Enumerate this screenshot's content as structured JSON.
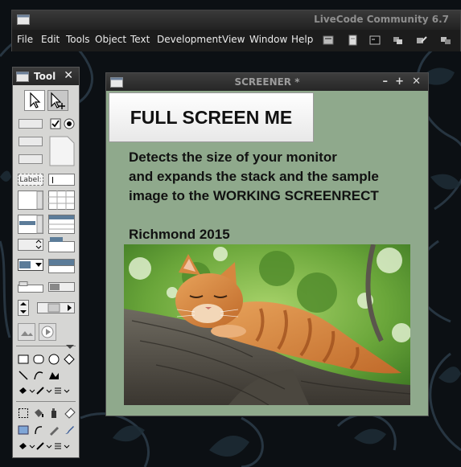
{
  "main_window": {
    "title": "LiveCode Community 6.7",
    "menu": [
      "File",
      "Edit",
      "Tools",
      "Object",
      "Text",
      "Development",
      "View",
      "Window",
      "Help"
    ],
    "toolbar_icons": [
      "inspector-icon",
      "message-box-icon",
      "application-browser-icon",
      "group-icon",
      "edit-group-icon",
      "select-grouped-icon"
    ]
  },
  "tools_palette": {
    "title": "Tool",
    "close_glyph": "✕",
    "label_tool_text": "Label:"
  },
  "screener": {
    "title": "SCREENER *",
    "controls": {
      "minimize": "–",
      "maximize": "+",
      "close": "✕"
    },
    "button_label": "FULL SCREEN ME",
    "description": [
      "Detects the size of your monitor",
      "and expands the stack and the sample",
      "image to the WORKING SCREENRECT"
    ],
    "author": "Richmond 2015",
    "image_subject": "ginger-cat-on-tree-branch"
  },
  "colors": {
    "stack_background": "#8fa98c",
    "titlebar": "#2a2a2a",
    "desktop": "#0c1014"
  }
}
